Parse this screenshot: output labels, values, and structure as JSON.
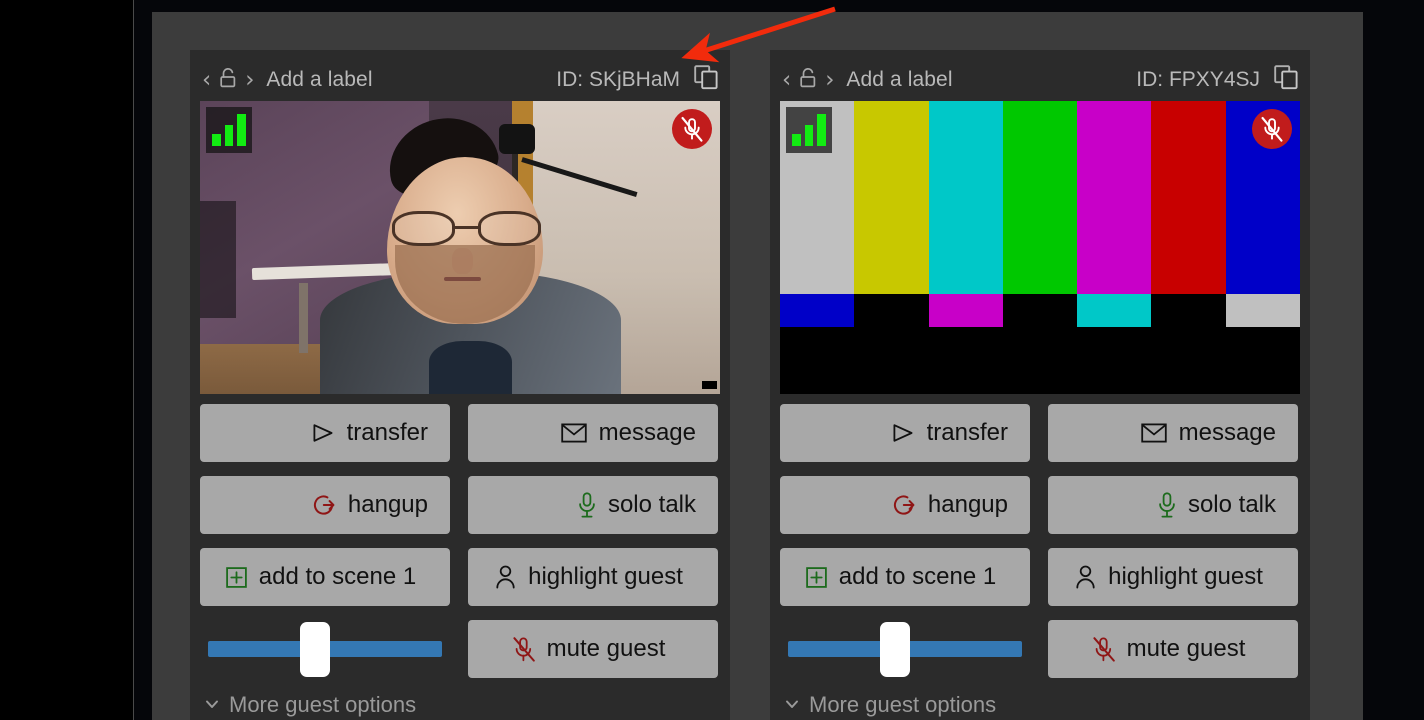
{
  "app": {
    "background_color": "#05060a",
    "panel_color": "#3c3c3c",
    "card_color": "#2b2b2b",
    "button_color": "#a8a8a8",
    "slider_color": "#3478b4",
    "accent_red": "#c11c1c",
    "accent_green": "#12ec12",
    "annotation_color": "#f22b0c"
  },
  "guests": [
    {
      "nav": {
        "prev_icon": "chevron-left-icon",
        "lock_icon": "unlocked-padlock-icon",
        "next_icon": "chevron-right-icon"
      },
      "label_placeholder": "Add a label",
      "id_text": "ID: SKjBHaM",
      "copy_icon": "copy-icon",
      "video": {
        "kind": "webcam",
        "signal_icon": "signal-bars-icon",
        "signal_bars": 3,
        "mute_icon": "microphone-muted-icon",
        "muted": true
      },
      "buttons": [
        {
          "label": "transfer",
          "icon": "transfer-icon",
          "icon_color": "#111111",
          "align": "right"
        },
        {
          "label": "message",
          "icon": "envelope-icon",
          "icon_color": "#111111",
          "align": "right"
        },
        {
          "label": "hangup",
          "icon": "hangup-icon",
          "icon_color": "#8f1616",
          "align": "right"
        },
        {
          "label": "solo talk",
          "icon": "microphone-icon",
          "icon_color": "#1c6b1c",
          "align": "right"
        },
        {
          "label": "add to scene 1",
          "icon": "plus-box-icon",
          "icon_color": "#1c6b1c",
          "align": "center"
        },
        {
          "label": "highlight guest",
          "icon": "person-icon",
          "icon_color": "#111111",
          "align": "center"
        },
        {
          "label": "mute guest",
          "icon": "microphone-muted-icon",
          "icon_color": "#8f1616",
          "align": "center"
        }
      ],
      "volume": {
        "name": "volume-slider",
        "value": 45,
        "min": 0,
        "max": 100
      },
      "more_options": "More guest options"
    },
    {
      "nav": {
        "prev_icon": "chevron-left-icon",
        "lock_icon": "unlocked-padlock-icon",
        "next_icon": "chevron-right-icon"
      },
      "label_placeholder": "Add a label",
      "id_text": "ID: FPXY4SJ",
      "copy_icon": "copy-icon",
      "video": {
        "kind": "smpte-color-bars",
        "signal_icon": "signal-bars-icon",
        "signal_bars": 3,
        "mute_icon": "microphone-muted-icon",
        "muted": true,
        "bars_row1": [
          "#c0c0c0",
          "#c8c800",
          "#00c8c8",
          "#00c800",
          "#c800c8",
          "#c80000",
          "#0000c8"
        ],
        "bars_row2": [
          "#0000c8",
          "#000000",
          "#c800c8",
          "#000000",
          "#00c8c8",
          "#000000",
          "#c0c0c0"
        ]
      },
      "buttons": [
        {
          "label": "transfer",
          "icon": "transfer-icon",
          "icon_color": "#111111",
          "align": "right"
        },
        {
          "label": "message",
          "icon": "envelope-icon",
          "icon_color": "#111111",
          "align": "right"
        },
        {
          "label": "hangup",
          "icon": "hangup-icon",
          "icon_color": "#8f1616",
          "align": "right"
        },
        {
          "label": "solo talk",
          "icon": "microphone-icon",
          "icon_color": "#1c6b1c",
          "align": "right"
        },
        {
          "label": "add to scene 1",
          "icon": "plus-box-icon",
          "icon_color": "#1c6b1c",
          "align": "center"
        },
        {
          "label": "highlight guest",
          "icon": "person-icon",
          "icon_color": "#111111",
          "align": "center"
        },
        {
          "label": "mute guest",
          "icon": "microphone-muted-icon",
          "icon_color": "#8f1616",
          "align": "center"
        }
      ],
      "volume": {
        "name": "volume-slider",
        "value": 45,
        "min": 0,
        "max": 100
      },
      "more_options": "More guest options"
    }
  ]
}
